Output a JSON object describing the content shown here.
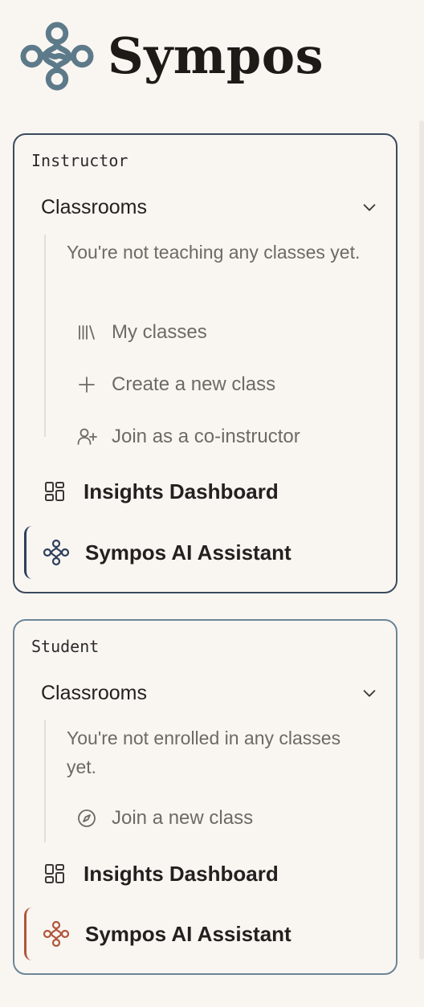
{
  "app": {
    "name": "Sympos",
    "brand_color": "#5d7a8a"
  },
  "instructor": {
    "role_label": "Instructor",
    "section_title": "Classrooms",
    "empty_message": "You're not teaching any classes yet.",
    "items": [
      {
        "label": "My classes",
        "icon": "library-icon"
      },
      {
        "label": "Create a new class",
        "icon": "plus-icon"
      },
      {
        "label": "Join as a co-instructor",
        "icon": "user-plus-icon"
      }
    ],
    "insights_label": "Insights Dashboard",
    "assistant_label": "Sympos AI Assistant",
    "accent_color": "#2e3f5c"
  },
  "student": {
    "role_label": "Student",
    "section_title": "Classrooms",
    "empty_message": "You're not enrolled in any classes yet.",
    "items": [
      {
        "label": "Join a new class",
        "icon": "compass-icon"
      }
    ],
    "insights_label": "Insights Dashboard",
    "assistant_label": "Sympos AI Assistant",
    "accent_color": "#b0563a"
  }
}
